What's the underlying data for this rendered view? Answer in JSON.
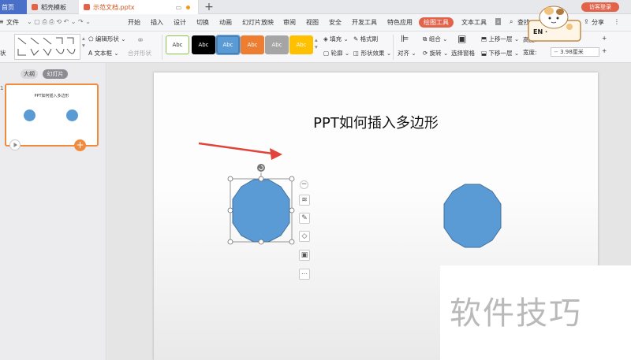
{
  "tabs": {
    "home": "首页",
    "templates": "稻壳模板",
    "document": "示范文档.pptx",
    "visitor_login": "访客登录"
  },
  "menu": {
    "file": "文件",
    "items": [
      "开始",
      "插入",
      "设计",
      "切换",
      "动画",
      "幻灯片放映",
      "审阅",
      "视图",
      "安全",
      "开发工具",
      "特色应用",
      "绘图工具",
      "文本工具"
    ],
    "active": "绘图工具",
    "search": "查找",
    "share": "分享"
  },
  "ribbon": {
    "edit_shape": "编辑形状",
    "text_box": "文本框",
    "merge_shapes": "合并形状",
    "style_labels": [
      "Abc",
      "Abc",
      "Abc",
      "Abc",
      "Abc",
      "Abc"
    ],
    "style_colors": [
      "#ffffff",
      "#000000",
      "#5b9bd5",
      "#ed7d31",
      "#a5a5a5",
      "#ffc000"
    ],
    "fill": "填充",
    "format_brush": "格式刷",
    "outline": "轮廓",
    "shape_effects": "形状效果",
    "align": "对齐",
    "group": "组合",
    "rotate": "旋转",
    "selection_pane": "选择窗格",
    "bring_forward": "上移一层",
    "send_backward": "下移一层",
    "height_label": "高度:",
    "width_label": "宽度:",
    "width_value": "3.98厘米",
    "left_label_1": "状"
  },
  "left_panel": {
    "outline_tab": "大纲",
    "slides_tab": "幻灯片",
    "thumb_title": "PPT如何插入多边形",
    "slide_number": "1"
  },
  "slide": {
    "title": "PPT如何插入多边形",
    "shape_color": "#5b9bd5",
    "arrow_color": "#e0443a"
  },
  "watermark": "软件技巧",
  "mascot_badge": "EN ·"
}
